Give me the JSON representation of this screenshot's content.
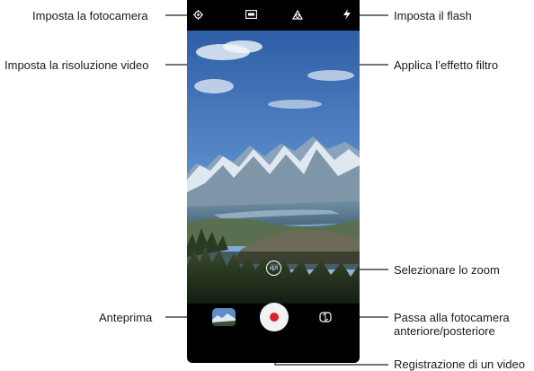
{
  "labels": {
    "camera_settings": "Imposta la fotocamera",
    "video_resolution": "Imposta la risoluzione video",
    "flash": "Imposta il flash",
    "filter": "Applica l’effetto filtro",
    "zoom": "Selezionare lo zoom",
    "preview": "Anteprima",
    "switch_camera_line1": "Passa alla fotocamera",
    "switch_camera_line2": "anteriore/posteriore",
    "record": "Registrazione di un video"
  },
  "zoom_button_text": "x1.0",
  "colors": {
    "record": "#e0202a",
    "callout_line": "#222222"
  },
  "icons": [
    "gear-icon",
    "video-resolution-icon",
    "filter-icon",
    "flash-icon",
    "zoom-icon",
    "gallery-preview-icon",
    "record-icon",
    "switch-camera-icon"
  ]
}
